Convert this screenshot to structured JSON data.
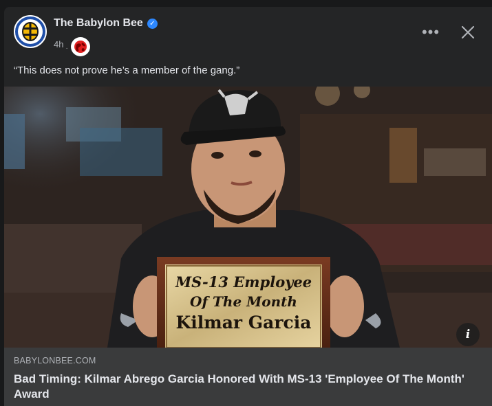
{
  "post": {
    "page_name": "The Babylon Bee",
    "time": "4h",
    "caption": "“This does not prove he’s a member of the gang.”"
  },
  "image": {
    "plaque_line1": "MS-13 Employee",
    "plaque_line2": "Of The Month",
    "plaque_line3": "Kilmar Garcia"
  },
  "link": {
    "domain": "BABYLONBEE.COM",
    "headline": "Bad Timing: Kilmar Abrego Garcia Honored With MS-13 'Employee Of The Month' Award"
  },
  "icons": {
    "verified": "verified-badge-icon",
    "audience": "globe-icon",
    "more": "more-options-icon",
    "close": "close-icon",
    "info": "info-icon"
  },
  "colors": {
    "card_background": "#242526",
    "link_background": "#3a3b3c",
    "verified_blue": "#2d88ff",
    "text_primary": "#e4e6eb",
    "text_secondary": "#b0b3b8"
  }
}
